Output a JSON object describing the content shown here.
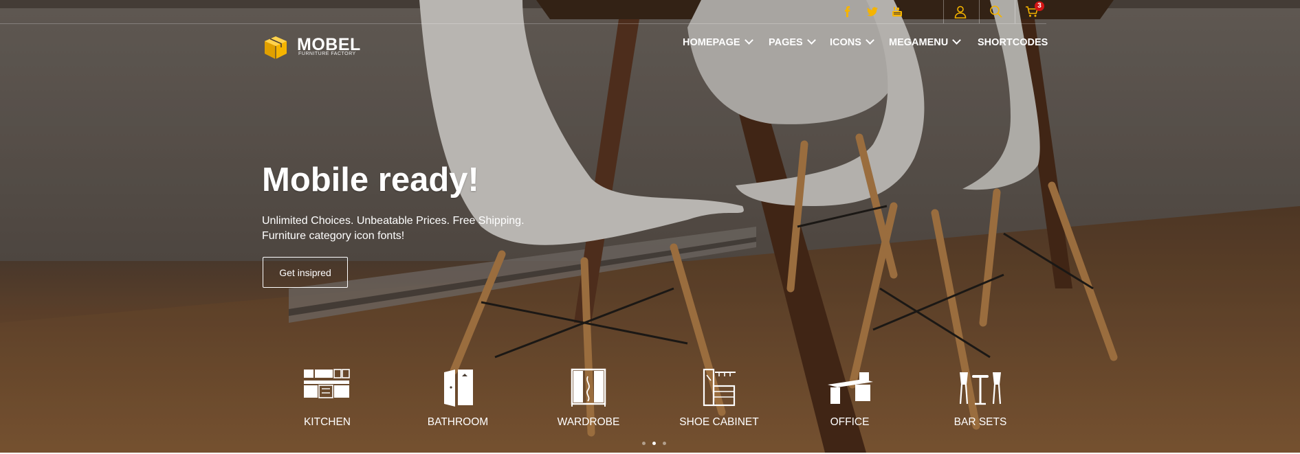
{
  "brand": {
    "name": "MOBEL",
    "tagline": "FURNITURE FACTORY",
    "accent_color": "#f5b400"
  },
  "topbar": {
    "social": [
      "facebook-icon",
      "twitter-icon",
      "youtube-icon"
    ],
    "tools": [
      "user-icon",
      "search-icon",
      "cart-icon"
    ],
    "cart_count": "3"
  },
  "nav": {
    "items": [
      {
        "label": "HOMEPAGE",
        "has_dropdown": true
      },
      {
        "label": "PAGES",
        "has_dropdown": true
      },
      {
        "label": "ICONS",
        "has_dropdown": true
      },
      {
        "label": "MEGAMENU",
        "has_dropdown": true
      },
      {
        "label": "SHORTCODES",
        "has_dropdown": false
      }
    ]
  },
  "hero": {
    "headline": "Mobile ready!",
    "subtitle_line1": "Unlimited Choices. Unbeatable Prices. Free Shipping.",
    "subtitle_line2": "Furniture category icon fonts!",
    "cta_label": "Get insipred"
  },
  "categories": [
    {
      "label": "KITCHEN",
      "icon": "kitchen-icon"
    },
    {
      "label": "BATHROOM",
      "icon": "bathroom-icon"
    },
    {
      "label": "WARDROBE",
      "icon": "wardrobe-icon"
    },
    {
      "label": "SHOE CABINET",
      "icon": "shoe-cabinet-icon"
    },
    {
      "label": "OFFICE",
      "icon": "office-icon"
    },
    {
      "label": "BAR SETS",
      "icon": "bar-sets-icon"
    }
  ],
  "slider": {
    "dot_count": 3,
    "active_index": 1
  }
}
